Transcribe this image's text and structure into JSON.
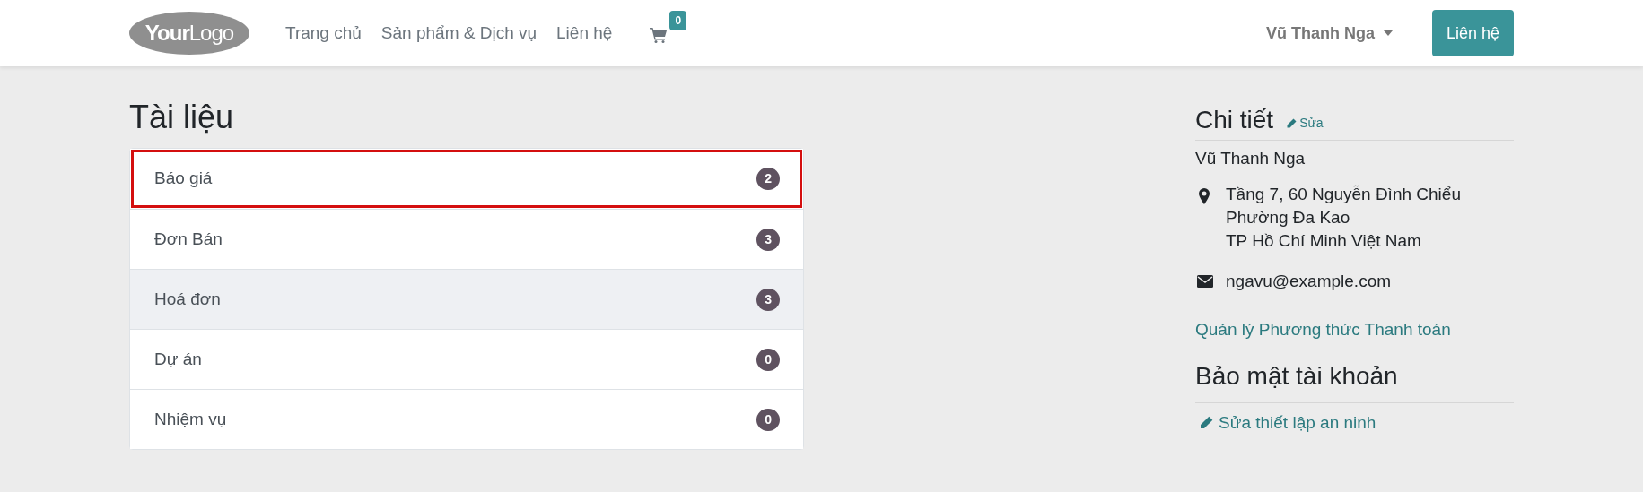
{
  "header": {
    "logo": {
      "bold": "Your",
      "light": "Logo"
    },
    "nav": [
      {
        "label": "Trang chủ"
      },
      {
        "label": "Sản phẩm & Dịch vụ"
      },
      {
        "label": "Liên hệ"
      }
    ],
    "cart_count": "0",
    "user_menu": "Vũ Thanh Nga",
    "contact_button": "Liên hệ"
  },
  "documents": {
    "title": "Tài liệu",
    "items": [
      {
        "label": "Báo giá",
        "count": "2",
        "highlighted": true,
        "hovered": false
      },
      {
        "label": "Đơn Bán",
        "count": "3",
        "highlighted": false,
        "hovered": false
      },
      {
        "label": "Hoá đơn",
        "count": "3",
        "highlighted": false,
        "hovered": true
      },
      {
        "label": "Dự án",
        "count": "0",
        "highlighted": false,
        "hovered": false
      },
      {
        "label": "Nhiệm vụ",
        "count": "0",
        "highlighted": false,
        "hovered": false
      }
    ]
  },
  "details": {
    "title": "Chi tiết",
    "edit_link": "Sửa",
    "name": "Vũ Thanh Nga",
    "address": [
      "Tầng 7, 60 Nguyễn Đình Chiểu",
      "Phường Đa Kao",
      "TP Hồ Chí Minh Việt Nam"
    ],
    "email": "ngavu@example.com",
    "payment_link": "Quản lý Phương thức Thanh toán"
  },
  "security": {
    "title": "Bảo mật tài khoản",
    "edit_link": "Sửa thiết lập an ninh"
  }
}
